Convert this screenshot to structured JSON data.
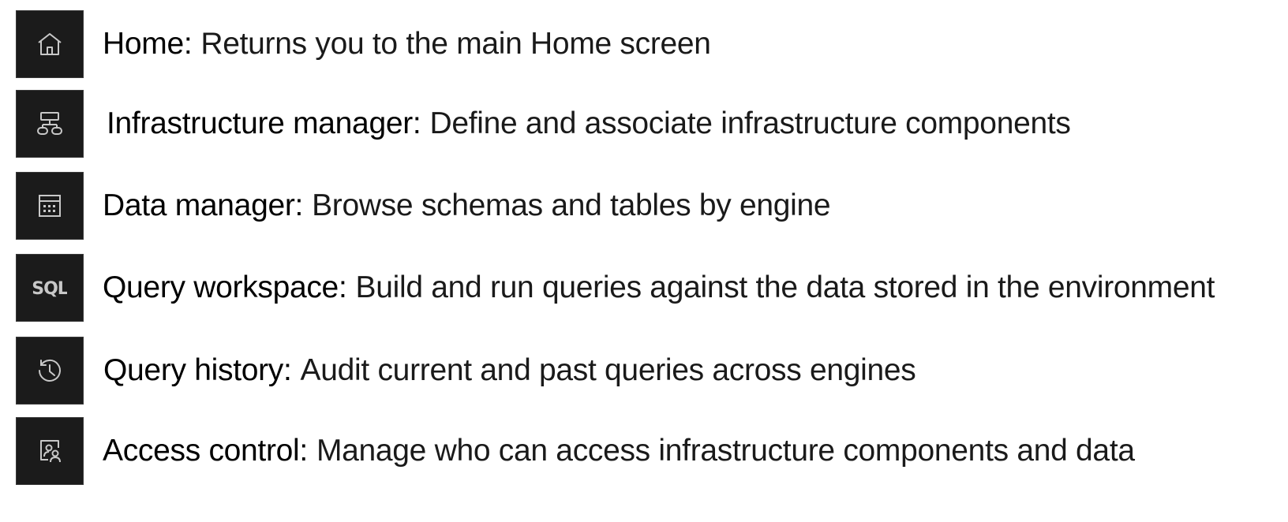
{
  "items": [
    {
      "icon": "home-icon",
      "term": "Home:",
      "description": "Returns you to the main Home screen"
    },
    {
      "icon": "infrastructure-icon",
      "term": "Infrastructure manager:",
      "description": "Define and associate infrastructure components"
    },
    {
      "icon": "data-manager-icon",
      "term": "Data manager:",
      "description": "Browse schemas and tables by engine"
    },
    {
      "icon": "sql-icon",
      "icon_text": "SQL",
      "term": "Query workspace:",
      "description": "Build and run queries against the data stored in the environment"
    },
    {
      "icon": "history-icon",
      "term": "Query history:",
      "description": "Audit current and past queries across engines"
    },
    {
      "icon": "access-control-icon",
      "term": "Access control:",
      "description": "Manage who can access infrastructure components and data"
    }
  ],
  "colors": {
    "icon_tile_bg": "#1b1b1b",
    "icon_stroke": "#c8c8c8",
    "text": "#111111"
  }
}
